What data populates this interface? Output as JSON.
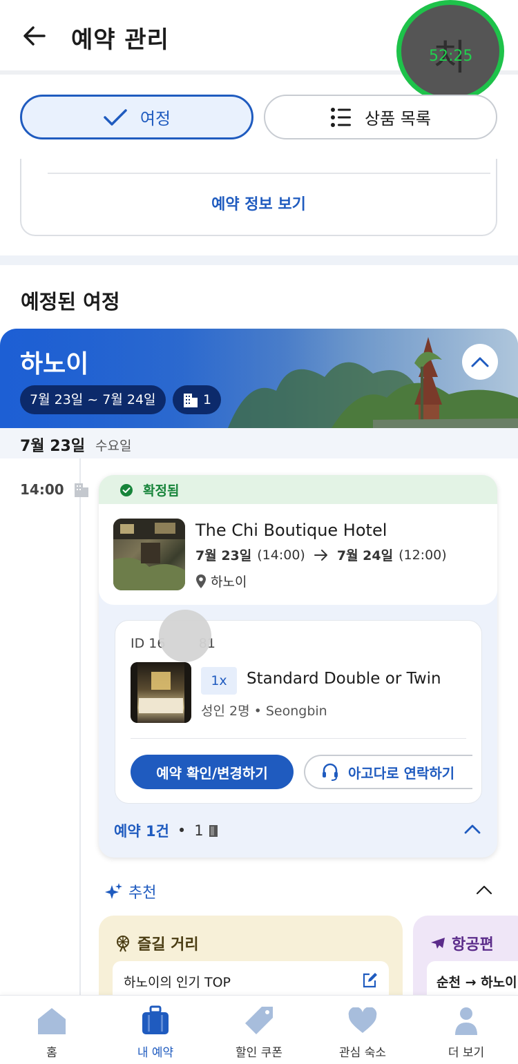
{
  "header": {
    "title": "예약 관리",
    "timer_char": "치",
    "timer_text": "52:25"
  },
  "segments": {
    "trip_label": "여정",
    "list_label": "상품 목록"
  },
  "info_card": {
    "link_label": "예약 정보 보기"
  },
  "section_title": "예정된 여정",
  "banner": {
    "city": "하노이",
    "date_range": "7월 23일 ~ 7월 24일",
    "hotel_count": "1"
  },
  "date_row": {
    "date": "7월 23일",
    "weekday": "수요일"
  },
  "timeline": {
    "time": "14:00"
  },
  "booking": {
    "status": "확정됨",
    "hotel_name": "The Chi Boutique Hotel",
    "checkin_date": "7월 23일",
    "checkin_time": "(14:00)",
    "checkout_date": "7월 24일",
    "checkout_time": "(12:00)",
    "location": "하노이",
    "room": {
      "id": "ID 16        81",
      "qty": "1x",
      "name": "Standard Double or Twin",
      "guests": "성인 2명 • Seongbin"
    },
    "manage_button": "예약 확인/변경하기",
    "contact_button": "아고다로 연락하기",
    "summary_count": "예약 1건",
    "summary_dot": "•",
    "summary_rooms": "1"
  },
  "recommendation": {
    "header": "추천",
    "fun_title": "즐길 거리",
    "fun_item": "하노이의 인기 TOP",
    "flight_title": "항공편",
    "flight_route": "순천 → 하노이"
  },
  "bottom_nav": {
    "items": [
      {
        "label": "홈",
        "icon": "home-icon"
      },
      {
        "label": "내 예약",
        "icon": "suitcase-icon"
      },
      {
        "label": "할인 쿠폰",
        "icon": "tag-icon"
      },
      {
        "label": "관심 숙소",
        "icon": "heart-icon"
      },
      {
        "label": "더 보기",
        "icon": "person-icon"
      }
    ],
    "active_index": 1
  },
  "colors": {
    "brand_blue": "#1f5bbf",
    "confirmed_green": "#17843a",
    "timer_green": "#1ec24a"
  }
}
